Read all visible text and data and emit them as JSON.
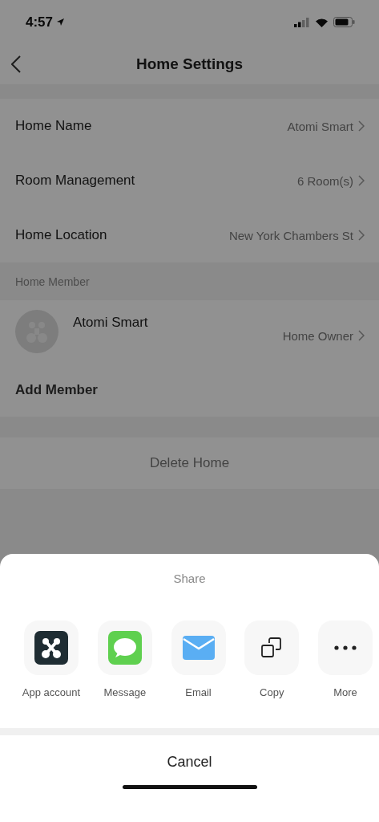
{
  "status_bar": {
    "time": "4:57"
  },
  "nav": {
    "title": "Home Settings"
  },
  "settings": [
    {
      "label": "Home Name",
      "value": "Atomi Smart"
    },
    {
      "label": "Room Management",
      "value": "6 Room(s)"
    },
    {
      "label": "Home Location",
      "value": "New York Chambers St"
    }
  ],
  "member_section": {
    "header": "Home Member",
    "members": [
      {
        "name": "Atomi Smart",
        "role": "Home Owner"
      }
    ],
    "add_label": "Add Member"
  },
  "delete_label": "Delete Home",
  "share_sheet": {
    "title": "Share",
    "targets": [
      {
        "kind": "app",
        "label": "App account"
      },
      {
        "kind": "message",
        "label": "Message"
      },
      {
        "kind": "email",
        "label": "Email"
      },
      {
        "kind": "copy",
        "label": "Copy"
      },
      {
        "kind": "more",
        "label": "More"
      }
    ],
    "cancel": "Cancel"
  }
}
